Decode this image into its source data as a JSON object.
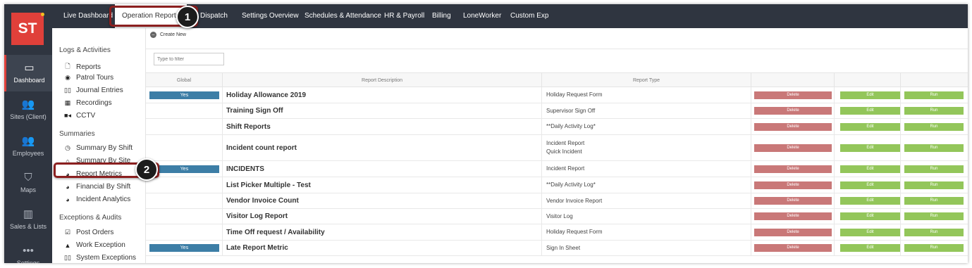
{
  "app": {
    "logo_text": "ST"
  },
  "rail": [
    {
      "label": "Dashboard",
      "icon": "monitor-icon",
      "glyph": "▭",
      "active": true
    },
    {
      "label": "Sites (Client)",
      "icon": "people-icon",
      "glyph": "👥",
      "active": false
    },
    {
      "label": "Employees",
      "icon": "people-icon",
      "glyph": "👥",
      "active": false
    },
    {
      "label": "Maps",
      "icon": "map-icon",
      "glyph": "⛉",
      "active": false
    },
    {
      "label": "Sales & Lists",
      "icon": "bar-chart-icon",
      "glyph": "▥",
      "active": false
    },
    {
      "label": "Settings",
      "icon": "dots-icon",
      "glyph": "•••",
      "active": false
    }
  ],
  "topnav": {
    "tabs": [
      {
        "label": "Live Dashboard"
      },
      {
        "label": "Operation Reports"
      },
      {
        "label": "Dispatch"
      },
      {
        "label": "Settings Overview"
      },
      {
        "label": "Schedules & Attendance"
      },
      {
        "label": "HR & Payroll"
      },
      {
        "label": "Billing"
      },
      {
        "label": "LoneWorker"
      },
      {
        "label": "Custom Exp"
      }
    ],
    "active_tab": "Operation Reports"
  },
  "callouts": [
    "1",
    "2"
  ],
  "subnav": {
    "sections": [
      {
        "title": "Logs & Activities",
        "items": [
          {
            "label": "Reports",
            "icon": "document-icon",
            "glyph": "🗋"
          },
          {
            "label": "Patrol Tours",
            "icon": "target-icon",
            "glyph": "◉"
          },
          {
            "label": "Journal Entries",
            "icon": "book-icon",
            "glyph": "▯▯"
          },
          {
            "label": "Recordings",
            "icon": "film-icon",
            "glyph": "▦"
          },
          {
            "label": "CCTV",
            "icon": "camera-icon",
            "glyph": "■◂"
          }
        ]
      },
      {
        "title": "Summaries",
        "items": [
          {
            "label": "Summary By Shift",
            "icon": "clock-icon",
            "glyph": "◷"
          },
          {
            "label": "Summary By Site",
            "icon": "home-icon",
            "glyph": "⌂"
          },
          {
            "label": "Report Metrics",
            "icon": "pie-chart-icon",
            "glyph": "◕"
          },
          {
            "label": "Financial By Shift",
            "icon": "pie-chart-icon",
            "glyph": "◕"
          },
          {
            "label": "Incident Analytics",
            "icon": "pie-chart-icon",
            "glyph": "◕"
          }
        ]
      },
      {
        "title": "Exceptions & Audits",
        "items": [
          {
            "label": "Post Orders",
            "icon": "checkbox-icon",
            "glyph": "☑"
          },
          {
            "label": "Work Exception",
            "icon": "warning-icon",
            "glyph": "▲"
          },
          {
            "label": "System Exceptions",
            "icon": "book-icon",
            "glyph": "▯▯"
          }
        ]
      }
    ]
  },
  "toolbar": {
    "create_label": "Create New",
    "filter_placeholder": "Type to filter"
  },
  "table": {
    "headers": [
      "Global",
      "Report Description",
      "Report Type",
      "",
      "",
      ""
    ],
    "rows": [
      {
        "global": "Yes",
        "description": "Holiday Allowance 2019",
        "types": [
          "Holiday Request Form"
        ],
        "delete": "Delete",
        "edit": "Edit",
        "run": "Run"
      },
      {
        "global": "",
        "description": "Training Sign Off",
        "types": [
          "Supervisor Sign Off"
        ],
        "delete": "Delete",
        "edit": "Edit",
        "run": "Run"
      },
      {
        "global": "",
        "description": "Shift Reports",
        "types": [
          "**Daily Activity Log*"
        ],
        "delete": "Delete",
        "edit": "Edit",
        "run": "Run"
      },
      {
        "global": "",
        "description": "Incident count report",
        "types": [
          "Incident Report",
          "Quick Incident"
        ],
        "delete": "Delete",
        "edit": "Edit",
        "run": "Run"
      },
      {
        "global": "Yes",
        "description": "INCIDENTS",
        "types": [
          "Incident Report"
        ],
        "delete": "Delete",
        "edit": "Edit",
        "run": "Run"
      },
      {
        "global": "",
        "description": "List Picker Multiple - Test",
        "types": [
          "**Daily Activity Log*"
        ],
        "delete": "Delete",
        "edit": "Edit",
        "run": "Run"
      },
      {
        "global": "",
        "description": "Vendor Invoice Count",
        "types": [
          "Vendor Invoice Report"
        ],
        "delete": "Delete",
        "edit": "Edit",
        "run": "Run"
      },
      {
        "global": "",
        "description": "Visitor Log Report",
        "types": [
          "Visitor Log"
        ],
        "delete": "Delete",
        "edit": "Edit",
        "run": "Run"
      },
      {
        "global": "",
        "description": "Time Off request / Availability",
        "types": [
          "Holiday Request Form"
        ],
        "delete": "Delete",
        "edit": "Edit",
        "run": "Run"
      },
      {
        "global": "Yes",
        "description": "Late Report Metric",
        "types": [
          "Sign In Sheet"
        ],
        "delete": "Delete",
        "edit": "Edit",
        "run": "Run"
      }
    ]
  },
  "colors": {
    "rail": "#2f3540",
    "accent": "#e0403a",
    "yes": "#3d7ea6",
    "delete": "#c97878",
    "edit_run": "#93c65a",
    "callout_border": "#8b1f1f"
  }
}
